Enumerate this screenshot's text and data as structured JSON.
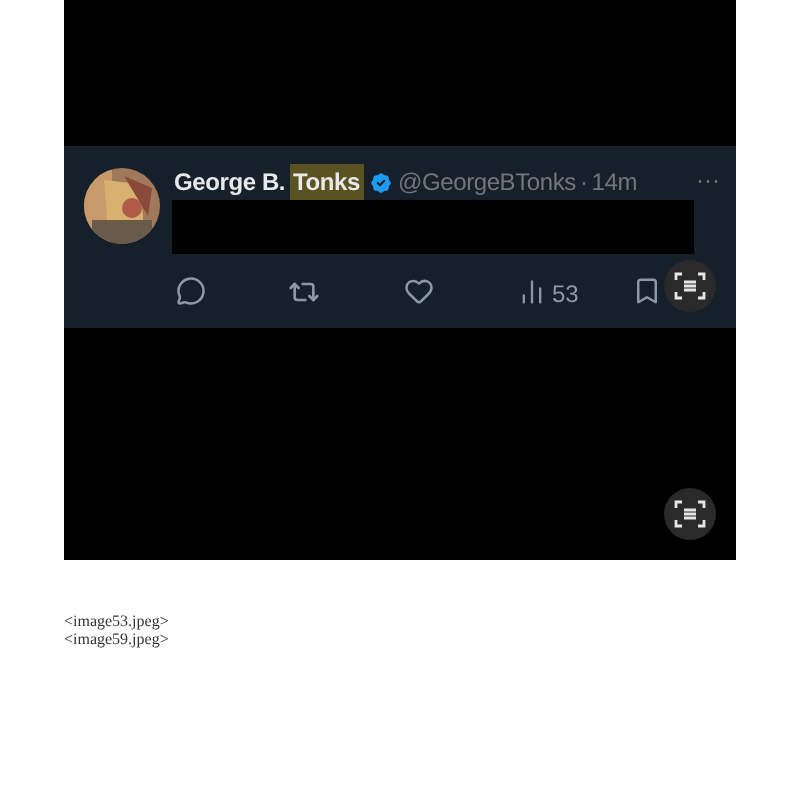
{
  "tweet": {
    "name_parts": [
      {
        "text": "George B.",
        "highlighted": false
      },
      {
        "text": "Tonks",
        "highlighted": true
      }
    ],
    "verified": true,
    "handle": "@GeorgeBTonks",
    "separator": "·",
    "time": "14m",
    "more": "···",
    "views": "53"
  },
  "captions": [
    "<image53.jpeg>",
    "<image59.jpeg>"
  ]
}
